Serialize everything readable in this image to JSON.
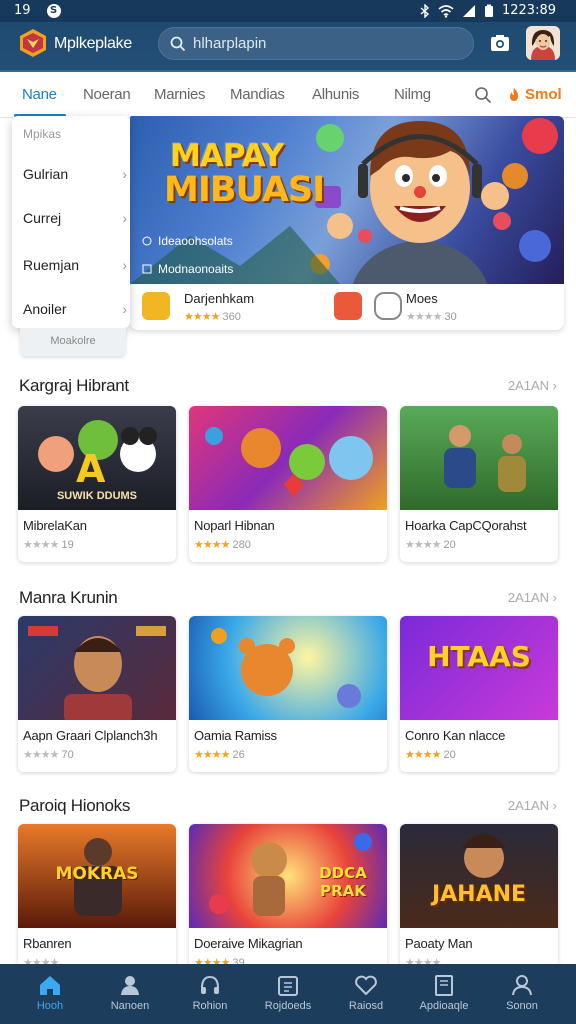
{
  "status": {
    "time": "19",
    "extra": "S",
    "right_time": "1223:89"
  },
  "appbar": {
    "title": "Mplkeplake",
    "search_value": "hlharplapin"
  },
  "tabs": [
    {
      "label": "Nane",
      "active": true
    },
    {
      "label": "Noeran"
    },
    {
      "label": "Marnies"
    },
    {
      "label": "Mandias"
    },
    {
      "label": "Alhunis"
    },
    {
      "label": "Nilmg"
    }
  ],
  "tab_badge": "Smol",
  "dropdown": {
    "header": "Mpikas",
    "items": [
      "Gulrian",
      "Currej",
      "Ruemjan",
      "Anoiler"
    ]
  },
  "chip_label": "Moakolre",
  "hero": {
    "title_line1": "MAPAY",
    "title_line2": "MIBUASI",
    "meta1": "Ideaoohsolats",
    "meta2": "Modnaonoaits",
    "apps": [
      {
        "name": "Darjenhkam",
        "rating": "360"
      },
      {
        "name": "Moes",
        "rating": "30"
      }
    ]
  },
  "sections": [
    {
      "title": "Kargraj Hibrant",
      "more": "2A1AN",
      "cards": [
        {
          "name": "MibrelaKan",
          "rating": "19",
          "banner": "SUWIK DDUMS"
        },
        {
          "name": "Noparl Hibnan",
          "rating": "280"
        },
        {
          "name": "Hoarka CapCQorahst",
          "rating": "20"
        }
      ]
    },
    {
      "title": "Manra Krunin",
      "more": "2A1AN",
      "cards": [
        {
          "name": "Aapn Graari Clplanch3h",
          "rating": "70"
        },
        {
          "name": "Oamia Ramiss",
          "rating": "26"
        },
        {
          "name": "Conro Kan nlacce",
          "rating": "20",
          "banner": "HTAAS"
        }
      ]
    },
    {
      "title": "Paroiq Hionoks",
      "more": "2A1AN",
      "cards": [
        {
          "name": "Rbanren",
          "rating": "",
          "banner": "MOKRAS"
        },
        {
          "name": "Doeraive Mikagrian",
          "rating": "39",
          "banner": "DDCA PRAK"
        },
        {
          "name": "Paoaty Man",
          "rating": "",
          "banner": "JAHANE"
        }
      ]
    }
  ],
  "nav": [
    {
      "label": "Hooh",
      "icon": "home-icon",
      "active": true
    },
    {
      "label": "Nanoen",
      "icon": "person-icon"
    },
    {
      "label": "Rohion",
      "icon": "headset-icon"
    },
    {
      "label": "Rojdoeds",
      "icon": "calendar-icon"
    },
    {
      "label": "Raiosd",
      "icon": "heart-icon"
    },
    {
      "label": "Apdioaqle",
      "icon": "book-icon"
    },
    {
      "label": "Sonon",
      "icon": "profile-icon"
    }
  ],
  "colors": {
    "accent": "#1e7fc9",
    "appbar": "#1f4a70",
    "navbar": "#1d3d5d",
    "badge": "#f07d1a",
    "star": "#f2a51b"
  }
}
